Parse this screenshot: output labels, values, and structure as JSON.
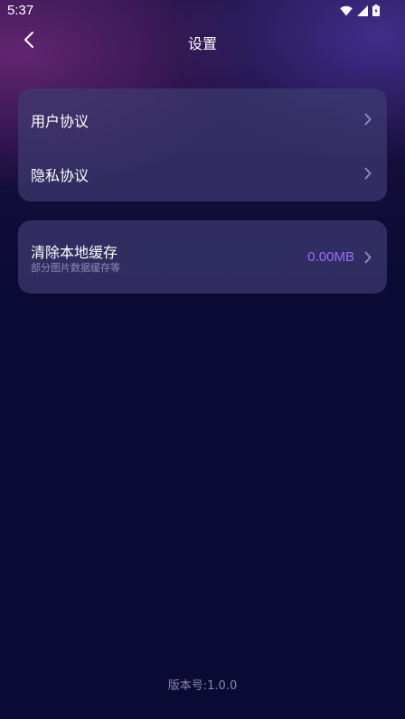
{
  "status_bar": {
    "time": "5:37",
    "icons": [
      "wifi-icon",
      "signal-icon",
      "battery-icon"
    ]
  },
  "header": {
    "title": "设置",
    "back_icon": "chevron-left-icon"
  },
  "settings_group_1": {
    "items": [
      {
        "label": "用户协议",
        "icon": "chevron-right-icon"
      },
      {
        "label": "隐私协议",
        "icon": "chevron-right-icon"
      }
    ]
  },
  "cache": {
    "label": "清除本地缓存",
    "description": "部分图片数据缓存等",
    "value": "0.00MB",
    "icon": "chevron-right-icon"
  },
  "footer": {
    "version": "版本号:1.0.0"
  },
  "colors": {
    "background": "#0a0a35",
    "card": "#3e3a70",
    "accent": "#9b6cff",
    "muted_text": "#8a86ad"
  }
}
